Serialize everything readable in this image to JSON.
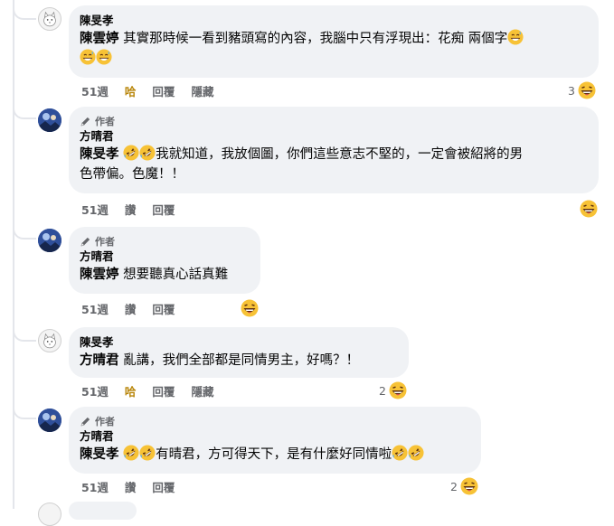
{
  "comments": [
    {
      "author": "陳旻孝",
      "is_author_badge": false,
      "mention": "陳雲婷",
      "text_line1": " 其實那時候一看到豬頭寫的內容，我腦中只有浮現出：花痴 兩個字",
      "time": "51週",
      "like_label": "哈",
      "reply_label": "回覆",
      "hide_label": "隱藏",
      "reaction_count": "3"
    },
    {
      "badge": "作者",
      "author": "方晴君",
      "mention": "陳旻孝",
      "text_line1": "我就知道，我放個圖，你們這些意志不堅的，一定會被紹將的男",
      "text_line2": "色帶偏。色魔！！",
      "time": "51週",
      "like_label": "讚",
      "reply_label": "回覆",
      "reaction_count": ""
    },
    {
      "badge": "作者",
      "author": "方晴君",
      "mention": "陳雲婷",
      "text_line1": " 想要聽真心話真難",
      "time": "51週",
      "like_label": "讚",
      "reply_label": "回覆",
      "reaction_count": ""
    },
    {
      "author": "陳旻孝",
      "mention": "方晴君",
      "text_line1": " 亂講，我們全部都是同情男主，好嗎？！",
      "time": "51週",
      "like_label": "哈",
      "reply_label": "回覆",
      "hide_label": "隱藏",
      "reaction_count": "2"
    },
    {
      "badge": "作者",
      "author": "方晴君",
      "mention": "陳旻孝",
      "text_line1": "有晴君，方可得天下，是有什麼好同情啦",
      "time": "51週",
      "like_label": "讚",
      "reply_label": "回覆",
      "reaction_count": "2"
    }
  ],
  "icons": {
    "haha": "grinning-sweat-face-icon",
    "rofl": "rolling-laughing-face-icon",
    "reaction": "haha-reaction-icon",
    "pencil": "pencil-icon"
  },
  "colors": {
    "bubble": "#f0f2f5",
    "meta": "#65676b",
    "haha_active": "#b8860b",
    "emoji": "#f7c236"
  }
}
